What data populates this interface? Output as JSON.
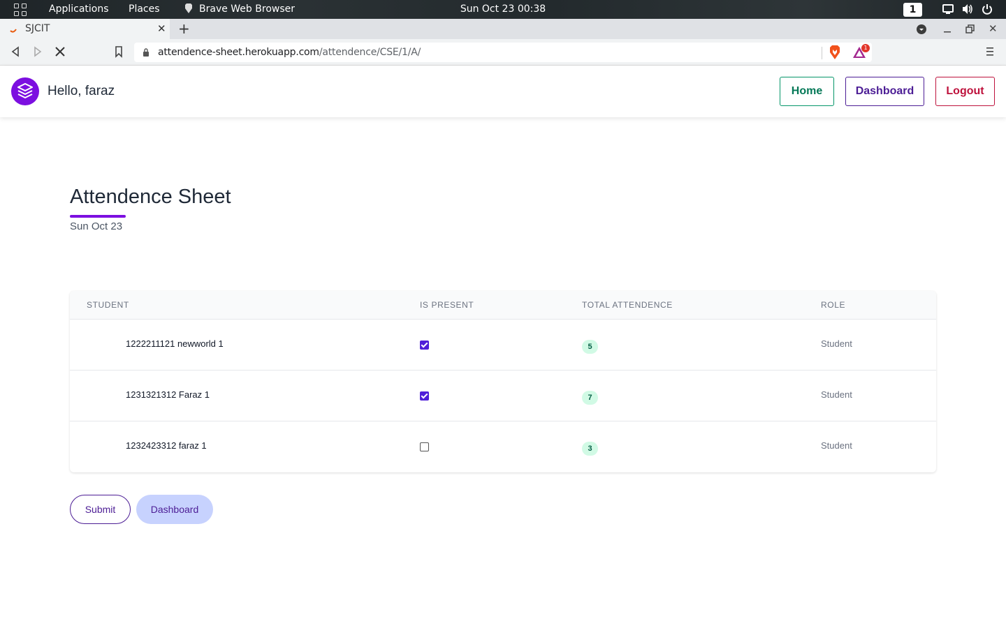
{
  "os_topbar": {
    "applications": "Applications",
    "places": "Places",
    "active_app": "Brave Web Browser",
    "clock": "Sun Oct 23  00:38",
    "workspace": "1"
  },
  "browser": {
    "tab_title": "SJCIT",
    "url_host": "attendence-sheet.herokuapp.com",
    "url_path": "/attendence/CSE/1/A/",
    "rewards_count": "1"
  },
  "header": {
    "greeting": "Hello, faraz",
    "home_label": "Home",
    "dashboard_label": "Dashboard",
    "logout_label": "Logout"
  },
  "page": {
    "title": "Attendence Sheet",
    "date": "Sun Oct 23"
  },
  "table": {
    "columns": [
      "STUDENT",
      "IS PRESENT",
      "TOTAL ATTENDENCE",
      "ROLE"
    ],
    "rows": [
      {
        "student": "1222211121 newworld 1",
        "present": true,
        "total": "5",
        "role": "Student"
      },
      {
        "student": "1231321312 Faraz 1",
        "present": true,
        "total": "7",
        "role": "Student"
      },
      {
        "student": "1232423312 faraz 1",
        "present": false,
        "total": "3",
        "role": "Student"
      }
    ]
  },
  "actions": {
    "submit_label": "Submit",
    "dashboard_label": "Dashboard"
  },
  "colors": {
    "accent": "#7c0fe0",
    "home": "#047857",
    "dashboard": "#4c1d95",
    "logout": "#be123c",
    "badge_bg": "#d1fae5",
    "checkbox": "#4f1fd8"
  }
}
